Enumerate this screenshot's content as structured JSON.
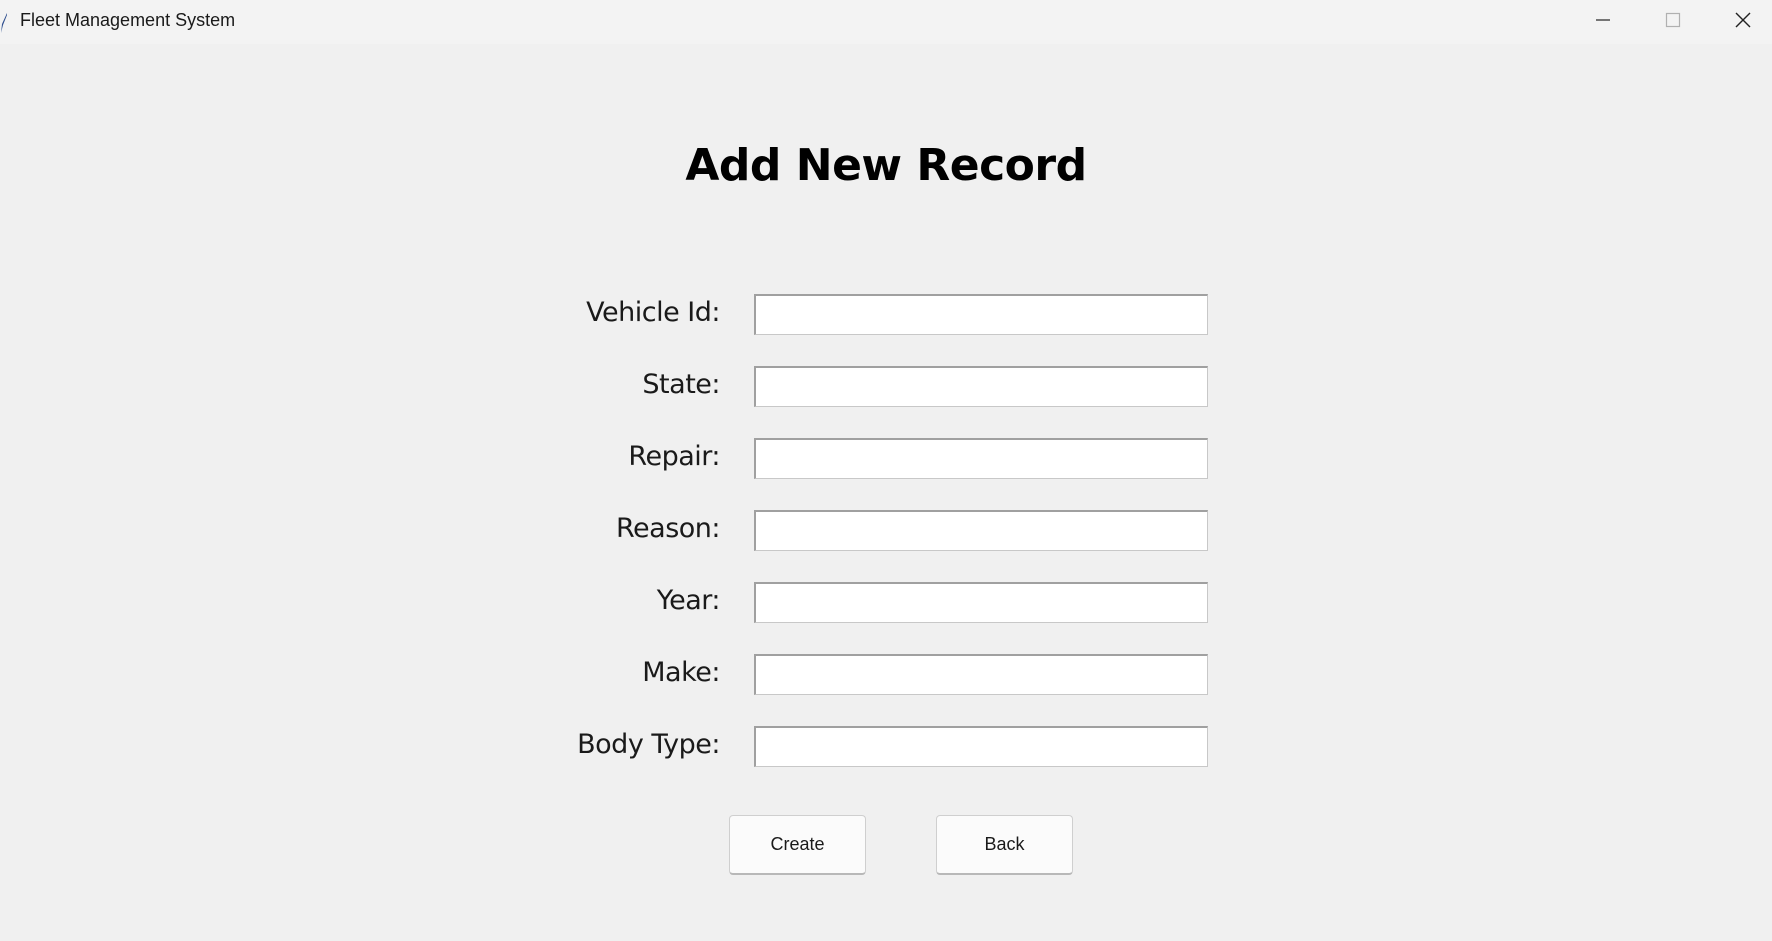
{
  "window": {
    "title": "Fleet Management System"
  },
  "form": {
    "heading": "Add New Record",
    "fields": [
      {
        "label": "Vehicle Id:",
        "value": ""
      },
      {
        "label": "State:",
        "value": ""
      },
      {
        "label": "Repair:",
        "value": ""
      },
      {
        "label": "Reason:",
        "value": ""
      },
      {
        "label": "Year:",
        "value": ""
      },
      {
        "label": "Make:",
        "value": ""
      },
      {
        "label": "Body Type:",
        "value": ""
      }
    ],
    "buttons": {
      "create": "Create",
      "back": "Back"
    }
  },
  "icons": {
    "app": "feather-icon",
    "minimize": "minimize-icon",
    "maximize": "maximize-icon",
    "close": "close-icon"
  }
}
